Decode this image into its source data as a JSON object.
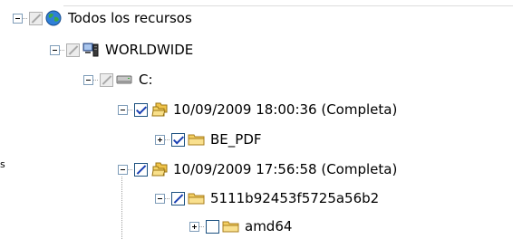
{
  "tree": {
    "root": {
      "label": "Todos los recursos",
      "icon": "globe-icon"
    },
    "server": {
      "label": "WORLDWIDE",
      "icon": "server-icon"
    },
    "drive": {
      "label": "C:",
      "icon": "drive-icon"
    },
    "backup_1": {
      "label": "10/09/2009 18:00:36 (Completa)",
      "icon": "backup-set-icon"
    },
    "folder_be_pdf": {
      "label": "BE_PDF",
      "icon": "folder-icon"
    },
    "backup_2": {
      "label": "10/09/2009 17:56:58 (Completa)",
      "icon": "backup-set-icon"
    },
    "folder_hash": {
      "label": "5111b92453f5725a56b2",
      "icon": "folder-icon"
    },
    "folder_amd64": {
      "label": "amd64",
      "icon": "folder-icon"
    }
  },
  "left_clip_text": "s"
}
